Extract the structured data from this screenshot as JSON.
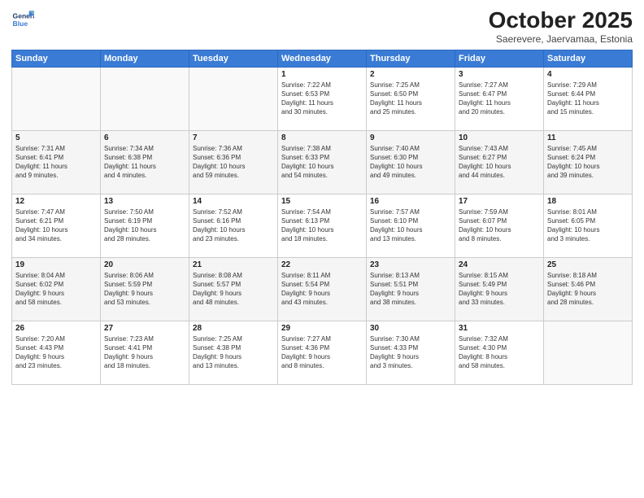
{
  "logo": {
    "line1": "General",
    "line2": "Blue"
  },
  "title": "October 2025",
  "subtitle": "Saerevere, Jaervamaa, Estonia",
  "headers": [
    "Sunday",
    "Monday",
    "Tuesday",
    "Wednesday",
    "Thursday",
    "Friday",
    "Saturday"
  ],
  "weeks": [
    [
      {
        "day": "",
        "info": ""
      },
      {
        "day": "",
        "info": ""
      },
      {
        "day": "",
        "info": ""
      },
      {
        "day": "1",
        "info": "Sunrise: 7:22 AM\nSunset: 6:53 PM\nDaylight: 11 hours\nand 30 minutes."
      },
      {
        "day": "2",
        "info": "Sunrise: 7:25 AM\nSunset: 6:50 PM\nDaylight: 11 hours\nand 25 minutes."
      },
      {
        "day": "3",
        "info": "Sunrise: 7:27 AM\nSunset: 6:47 PM\nDaylight: 11 hours\nand 20 minutes."
      },
      {
        "day": "4",
        "info": "Sunrise: 7:29 AM\nSunset: 6:44 PM\nDaylight: 11 hours\nand 15 minutes."
      }
    ],
    [
      {
        "day": "5",
        "info": "Sunrise: 7:31 AM\nSunset: 6:41 PM\nDaylight: 11 hours\nand 9 minutes."
      },
      {
        "day": "6",
        "info": "Sunrise: 7:34 AM\nSunset: 6:38 PM\nDaylight: 11 hours\nand 4 minutes."
      },
      {
        "day": "7",
        "info": "Sunrise: 7:36 AM\nSunset: 6:36 PM\nDaylight: 10 hours\nand 59 minutes."
      },
      {
        "day": "8",
        "info": "Sunrise: 7:38 AM\nSunset: 6:33 PM\nDaylight: 10 hours\nand 54 minutes."
      },
      {
        "day": "9",
        "info": "Sunrise: 7:40 AM\nSunset: 6:30 PM\nDaylight: 10 hours\nand 49 minutes."
      },
      {
        "day": "10",
        "info": "Sunrise: 7:43 AM\nSunset: 6:27 PM\nDaylight: 10 hours\nand 44 minutes."
      },
      {
        "day": "11",
        "info": "Sunrise: 7:45 AM\nSunset: 6:24 PM\nDaylight: 10 hours\nand 39 minutes."
      }
    ],
    [
      {
        "day": "12",
        "info": "Sunrise: 7:47 AM\nSunset: 6:21 PM\nDaylight: 10 hours\nand 34 minutes."
      },
      {
        "day": "13",
        "info": "Sunrise: 7:50 AM\nSunset: 6:19 PM\nDaylight: 10 hours\nand 28 minutes."
      },
      {
        "day": "14",
        "info": "Sunrise: 7:52 AM\nSunset: 6:16 PM\nDaylight: 10 hours\nand 23 minutes."
      },
      {
        "day": "15",
        "info": "Sunrise: 7:54 AM\nSunset: 6:13 PM\nDaylight: 10 hours\nand 18 minutes."
      },
      {
        "day": "16",
        "info": "Sunrise: 7:57 AM\nSunset: 6:10 PM\nDaylight: 10 hours\nand 13 minutes."
      },
      {
        "day": "17",
        "info": "Sunrise: 7:59 AM\nSunset: 6:07 PM\nDaylight: 10 hours\nand 8 minutes."
      },
      {
        "day": "18",
        "info": "Sunrise: 8:01 AM\nSunset: 6:05 PM\nDaylight: 10 hours\nand 3 minutes."
      }
    ],
    [
      {
        "day": "19",
        "info": "Sunrise: 8:04 AM\nSunset: 6:02 PM\nDaylight: 9 hours\nand 58 minutes."
      },
      {
        "day": "20",
        "info": "Sunrise: 8:06 AM\nSunset: 5:59 PM\nDaylight: 9 hours\nand 53 minutes."
      },
      {
        "day": "21",
        "info": "Sunrise: 8:08 AM\nSunset: 5:57 PM\nDaylight: 9 hours\nand 48 minutes."
      },
      {
        "day": "22",
        "info": "Sunrise: 8:11 AM\nSunset: 5:54 PM\nDaylight: 9 hours\nand 43 minutes."
      },
      {
        "day": "23",
        "info": "Sunrise: 8:13 AM\nSunset: 5:51 PM\nDaylight: 9 hours\nand 38 minutes."
      },
      {
        "day": "24",
        "info": "Sunrise: 8:15 AM\nSunset: 5:49 PM\nDaylight: 9 hours\nand 33 minutes."
      },
      {
        "day": "25",
        "info": "Sunrise: 8:18 AM\nSunset: 5:46 PM\nDaylight: 9 hours\nand 28 minutes."
      }
    ],
    [
      {
        "day": "26",
        "info": "Sunrise: 7:20 AM\nSunset: 4:43 PM\nDaylight: 9 hours\nand 23 minutes."
      },
      {
        "day": "27",
        "info": "Sunrise: 7:23 AM\nSunset: 4:41 PM\nDaylight: 9 hours\nand 18 minutes."
      },
      {
        "day": "28",
        "info": "Sunrise: 7:25 AM\nSunset: 4:38 PM\nDaylight: 9 hours\nand 13 minutes."
      },
      {
        "day": "29",
        "info": "Sunrise: 7:27 AM\nSunset: 4:36 PM\nDaylight: 9 hours\nand 8 minutes."
      },
      {
        "day": "30",
        "info": "Sunrise: 7:30 AM\nSunset: 4:33 PM\nDaylight: 9 hours\nand 3 minutes."
      },
      {
        "day": "31",
        "info": "Sunrise: 7:32 AM\nSunset: 4:30 PM\nDaylight: 8 hours\nand 58 minutes."
      },
      {
        "day": "",
        "info": ""
      }
    ]
  ]
}
